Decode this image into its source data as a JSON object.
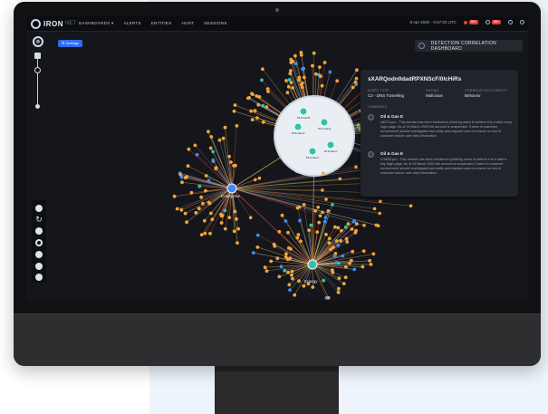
{
  "app": {
    "logo": "IRON",
    "logo_sub": "NET",
    "nav": [
      "DASHBOARDS ▾",
      "ALERTS",
      "ENTITIES",
      "HUNT",
      "SESSIONS"
    ],
    "date": "8 Apr 2020 · 9:47:34 UTC",
    "alert_count": "99+"
  },
  "toolbar": {
    "settings_label": "⚙ Settings"
  },
  "dashboard_button": {
    "label": "DETECTION CORRELATION DASHBOARD"
  },
  "detail": {
    "title": "sXARQodn0dadRPXNScF/0lcHiRs",
    "alert_type_label": "ALERT TYPE",
    "alert_type_value": "C2 - DNS Tunneling",
    "rating_label": "RATING",
    "rating_value": "Malicious",
    "context_label": "CORRELATION CONTEXT",
    "context_value": "Behavior",
    "comments_label": "COMMENTS",
    "comments": [
      {
        "title": "Oil & Gas E",
        "text": "sl82?5.pro - This domain has been involved in phishing users to believe it is a valid e-key login page. As of 24 March 2020 the account is suspended. If seen in customer environment should investigated and notify and request users to ensure no lost of customer and/or user step information."
      },
      {
        "title": "Oil & Gas E",
        "text": "s70825.pro - This domain has been involved in phishing users to believe it is a valid e-key login page. As of 24 March 2020 the account is suspended. If seen in customer environment should investigated and notify and request users to ensure no lost of customer and/or user step information."
      }
    ]
  },
  "graph": {
    "hubs": [
      "Oil & Gas",
      "Enterprise",
      "Energy"
    ],
    "cluster_nodes": [
      "Oil & Gas B",
      "Oil & Gas E",
      "Oil & Gas D",
      "Oil & Gas A",
      "Oil & Gas C"
    ]
  },
  "colors": {
    "accent": "#2e6cf0",
    "alert": "#e0443d",
    "node_orange": "#f0a63a",
    "node_teal": "#2ec4a8",
    "node_blue": "#3b8cff"
  }
}
